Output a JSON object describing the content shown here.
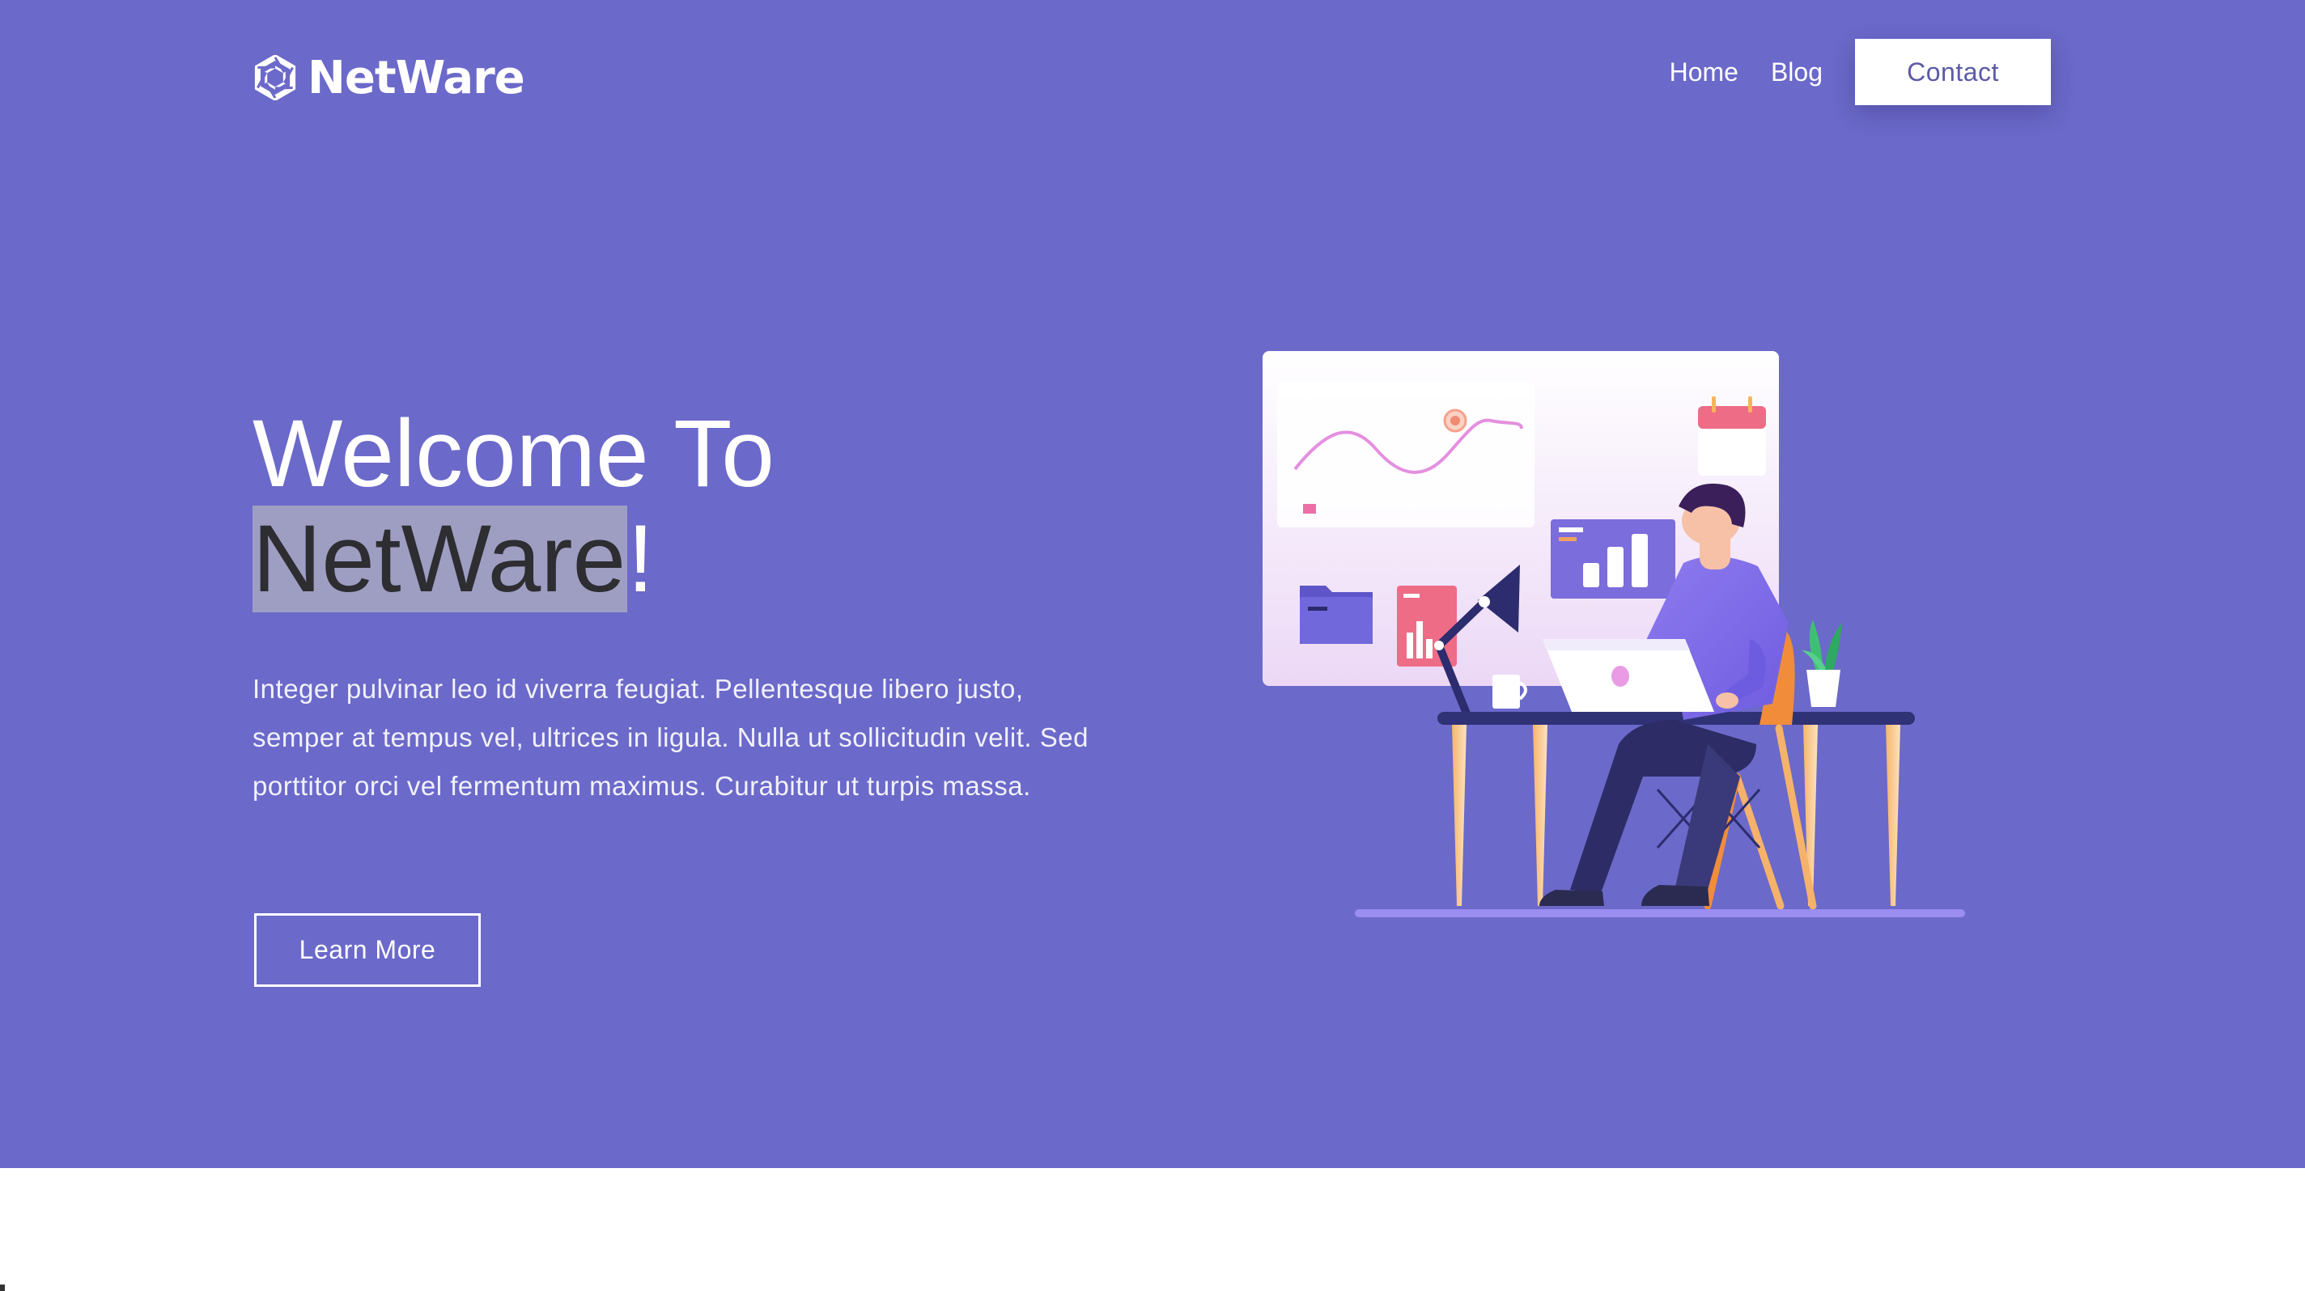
{
  "brand": {
    "name": "NetWare",
    "icon": "hexagon-aperture-icon"
  },
  "nav": {
    "links": [
      "Home",
      "Blog"
    ],
    "contact_label": "Contact"
  },
  "hero": {
    "title_line1": "Welcome To",
    "title_highlight": "NetWare",
    "title_suffix": "!",
    "description": "Integer pulvinar leo id viverra feugiat. Pellentesque libero justo, semper at tempus vel, ultrices in ligula. Nulla ut sollicitudin velit. Sed porttitor orci vel fermentum maximus. Curabitur ut turpis massa.",
    "cta_label": "Learn More",
    "illustration": "person-working-at-desk-with-dashboard-illustration"
  },
  "colors": {
    "hero_background": "#6b69c9",
    "text_highlight": "#9e9ec3",
    "contact_text": "#5c5aa6",
    "page_background": "#ffffff"
  }
}
